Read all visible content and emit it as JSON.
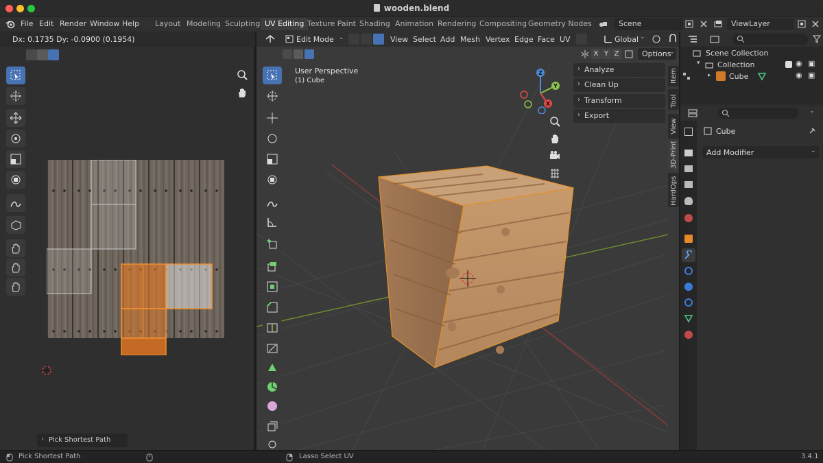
{
  "window": {
    "title": "wooden.blend"
  },
  "menu": [
    "File",
    "Edit",
    "Render",
    "Window",
    "Help"
  ],
  "workspaces": [
    "Layout",
    "Modeling",
    "Sculpting",
    "UV Editing",
    "Texture Paint",
    "Shading",
    "Animation",
    "Rendering",
    "Compositing",
    "Geometry Nodes"
  ],
  "active_workspace": "UV Editing",
  "scene": {
    "name": "Scene",
    "view_layer": "ViewLayer"
  },
  "uv_editor": {
    "readout": "Dx: 0.1735   Dy: -0.0900 (0.1954)",
    "operator_panel": "Pick Shortest Path"
  },
  "viewport": {
    "mode": "Edit Mode",
    "menus": [
      "View",
      "Select",
      "Add",
      "Mesh",
      "Vertex",
      "Edge",
      "Face",
      "UV"
    ],
    "orientation": "Global",
    "axes": [
      "X",
      "Y",
      "Z"
    ],
    "options_label": "Options",
    "overlay_line1": "User Perspective",
    "overlay_line2": "(1) Cube",
    "gizmo_axes": [
      "Z",
      "Y",
      "X"
    ],
    "npanel_items": [
      "Analyze",
      "Clean Up",
      "Transform",
      "Export"
    ],
    "side_tabs": [
      "Item",
      "Tool",
      "View",
      "3D-Print",
      "HardOps"
    ]
  },
  "outliner": {
    "root": "Scene Collection",
    "collection": "Collection",
    "object": "Cube"
  },
  "properties": {
    "object_name": "Cube",
    "add_modifier": "Add Modifier"
  },
  "status": {
    "left": "Pick Shortest Path",
    "middle": "Lasso Select UV",
    "version": "3.4.1"
  },
  "colors": {
    "accent": "#4772b3",
    "selection_orange": "#e07a28",
    "wood": "#b98a5e"
  }
}
